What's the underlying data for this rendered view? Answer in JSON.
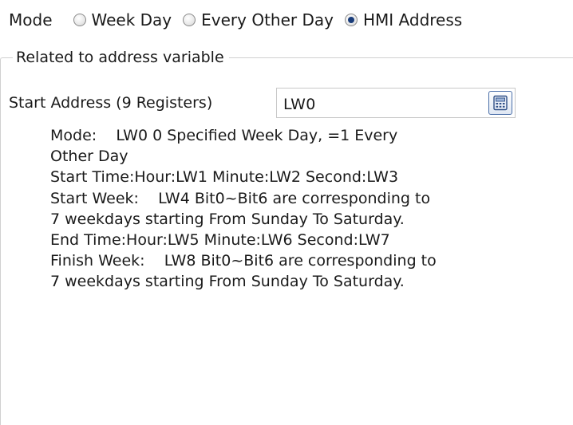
{
  "mode": {
    "label": "Mode",
    "options": [
      {
        "label": "Week Day",
        "checked": false
      },
      {
        "label": "Every Other Day",
        "checked": false
      },
      {
        "label": "HMI Address",
        "checked": true
      }
    ]
  },
  "group": {
    "title": "Related to address variable"
  },
  "start_address": {
    "label": "Start Address (9 Registers)",
    "value": "LW0",
    "button_icon": "calculator-icon"
  },
  "description": {
    "lines": [
      "Mode:    LW0 0 Specified Week Day, =1 Every",
      "Other Day",
      "Start Time:Hour:LW1 Minute:LW2 Second:LW3",
      "Start Week:    LW4 Bit0~Bit6 are corresponding to",
      "7 weekdays starting From Sunday To Saturday.",
      "End Time:Hour:LW5 Minute:LW6 Second:LW7",
      "Finish Week:    LW8 Bit0~Bit6 are corresponding to",
      "7 weekdays starting From Sunday To Saturday."
    ]
  },
  "colors": {
    "radio_dot": "#1a3d7a",
    "group_border": "#d0d0d0",
    "field_border": "#c8c8c8",
    "button_border": "#4a6ea8"
  }
}
